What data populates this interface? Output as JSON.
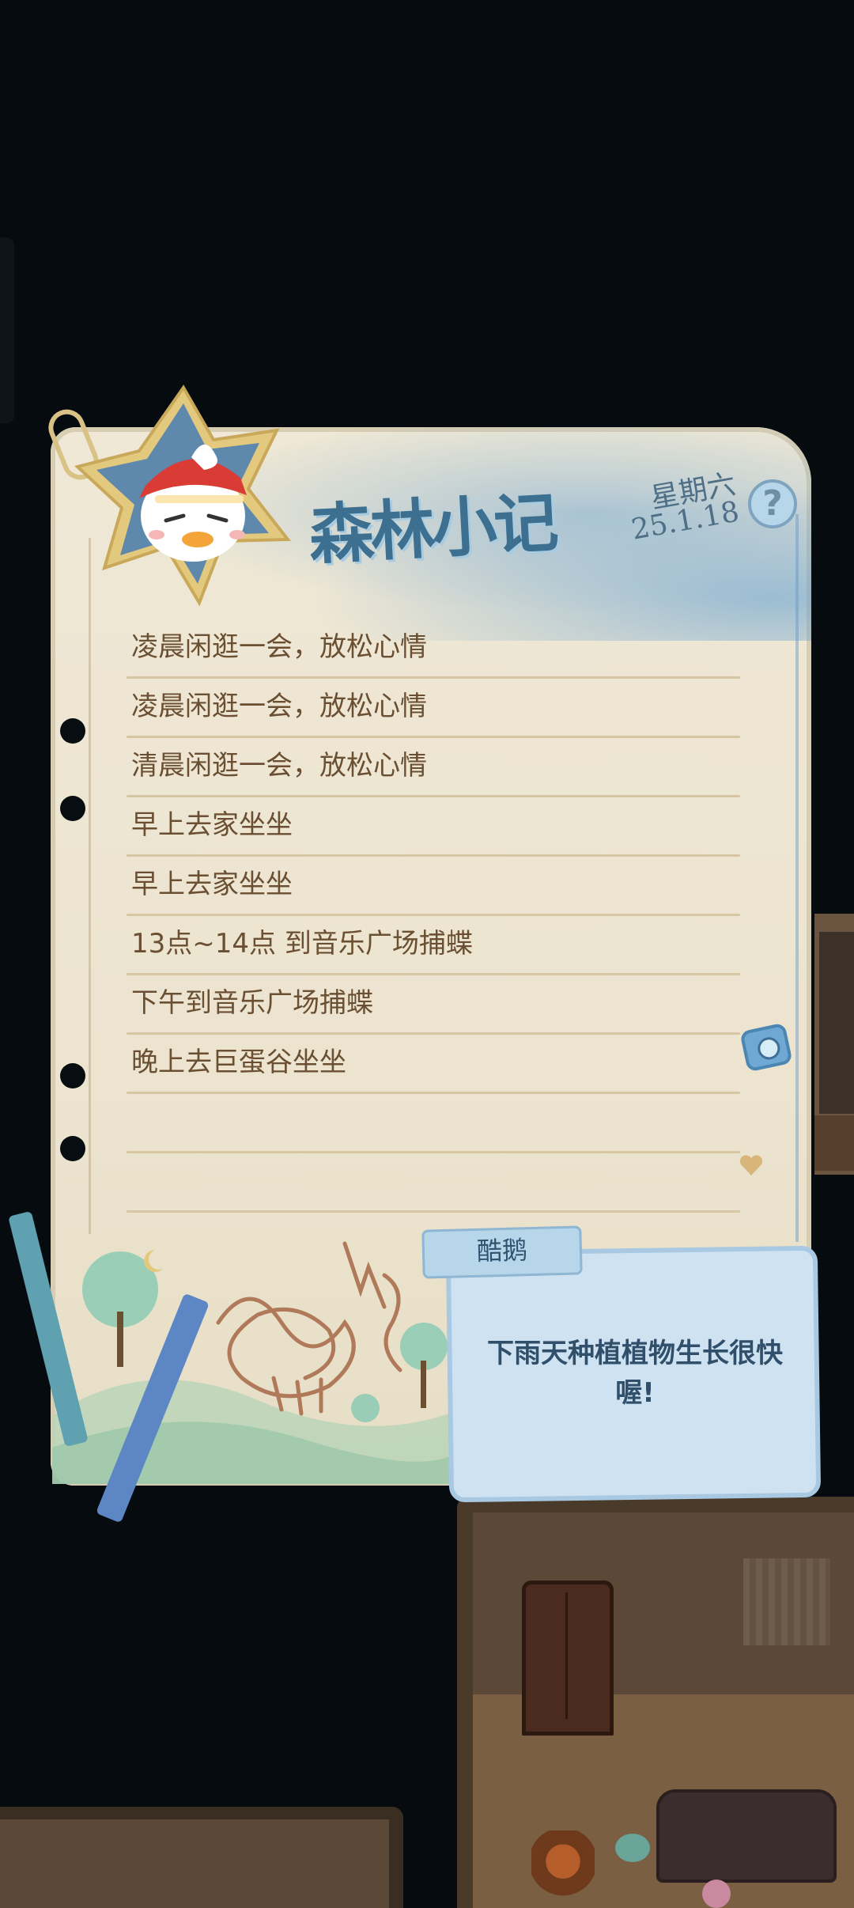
{
  "journal": {
    "title": "森林小记",
    "weekday": "星期六",
    "date": "25.1.18",
    "help_symbol": "?",
    "entries": [
      "凌晨闲逛一会，放松心情",
      "凌晨闲逛一会，放松心情",
      "清晨闲逛一会，放松心情",
      "早上去家坐坐",
      "早上去家坐坐",
      "13点~14点 到音乐广场捕蝶",
      "下午到音乐广场捕蝶",
      "晚上去巨蛋谷坐坐",
      "",
      ""
    ]
  },
  "tip": {
    "speaker": "酷鹅",
    "text": "下雨天种植植物生长很快喔!"
  },
  "icons": {
    "avatar": "duck-with-red-cap-avatar",
    "help": "question-mark-icon",
    "camera": "camera-icon",
    "heart": "heart-icon",
    "paperclip": "paperclip-icon"
  },
  "colors": {
    "title": "#3c6f90",
    "entry_text": "#6a4f32",
    "tip_card": "#cfe2f1",
    "background": "#060b10"
  }
}
